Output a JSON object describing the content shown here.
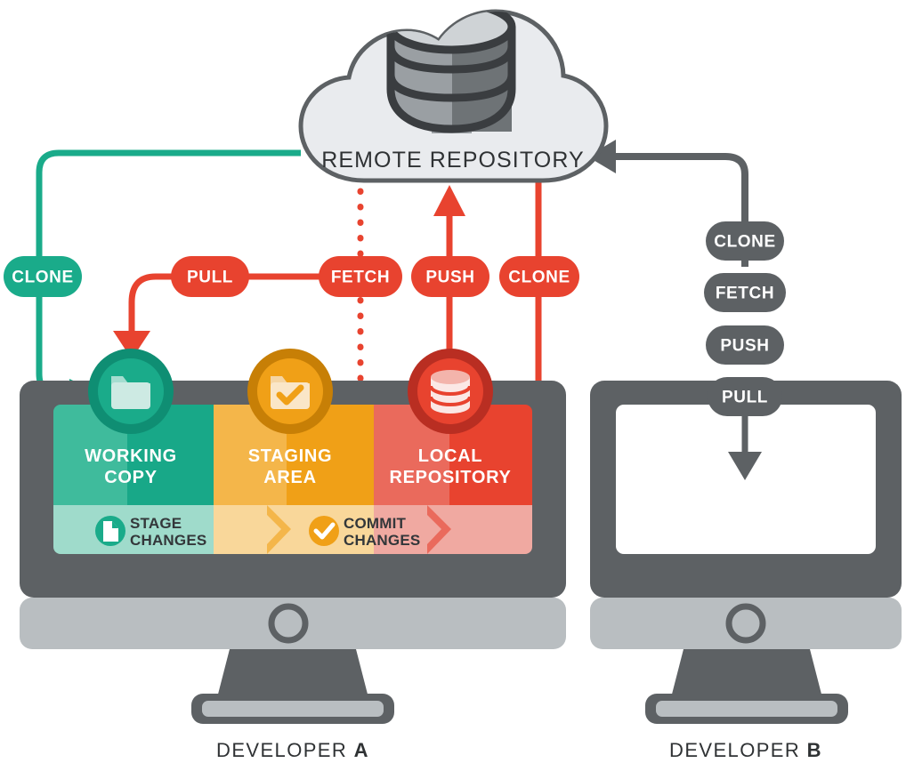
{
  "diagram": {
    "title": "Git distributed version control workflow",
    "background": "#ffffff"
  },
  "colors": {
    "green": "#1aab8a",
    "green_dark": "#0f8e73",
    "green_light": "#3fbb9c",
    "green_pale": "#9fdbcb",
    "green_icon_fill": "#cdeae3",
    "orange": "#f0a017",
    "orange_dark": "#c77f06",
    "orange_light": "#f4b64a",
    "orange_pale": "#f9d79a",
    "orange_icon_fill": "#fae6c8",
    "red": "#e8432f",
    "red_dark": "#b92e22",
    "red_light": "#ea6a5c",
    "red_pale": "#f0a9a1",
    "red_icon_fill": "#fbe8e5",
    "gray_dark": "#5d6164",
    "gray_mid": "#b9bec1",
    "gray_light": "#e9ebee",
    "ink": "#2f3234",
    "white": "#ffffff"
  },
  "cloud": {
    "label": "REMOTE REPOSITORY",
    "icon": "database-stack-icon",
    "fill": "#e9ebee",
    "stroke": "#5d6164"
  },
  "flow_labels": [
    {
      "id": "clone-green",
      "label": "CLONE",
      "color": "#1aab8a",
      "direction": "remote-to-working-copy"
    },
    {
      "id": "pull-red",
      "label": "PULL",
      "color": "#e8432f",
      "direction": "remote-to-working-copy"
    },
    {
      "id": "fetch-red",
      "label": "FETCH",
      "color": "#e8432f",
      "direction": "remote-to-local-repository"
    },
    {
      "id": "push-red",
      "label": "PUSH",
      "color": "#e8432f",
      "direction": "local-repository-to-remote"
    },
    {
      "id": "clone-red",
      "label": "CLONE",
      "color": "#e8432f",
      "direction": "remote-to-local-repository"
    }
  ],
  "developer_b_labels": [
    {
      "id": "clone-b",
      "label": "CLONE",
      "color": "#5d6164"
    },
    {
      "id": "fetch-b",
      "label": "FETCH",
      "color": "#5d6164"
    },
    {
      "id": "push-b",
      "label": "PUSH",
      "color": "#5d6164"
    },
    {
      "id": "pull-b",
      "label": "PULL",
      "color": "#5d6164"
    }
  ],
  "developer_a": {
    "caption_prefix": "DEVELOPER ",
    "caption_letter": "A",
    "columns": [
      {
        "id": "working-copy",
        "title_line1": "WORKING",
        "title_line2": "COPY",
        "icon": "folder-icon",
        "icon_ring": "#0f8e73",
        "icon_body": "#1aab8a",
        "fill_light": "#3fbb9c",
        "fill_dark": "#18a888",
        "strip_fill": "#9fdbcb"
      },
      {
        "id": "staging-area",
        "title_line1": "STAGING",
        "title_line2": "AREA",
        "icon": "folder-check-icon",
        "icon_ring": "#c77f06",
        "icon_body": "#f0a017",
        "fill_light": "#f4b64a",
        "fill_dark": "#f0a017",
        "strip_fill": "#f9d79a"
      },
      {
        "id": "local-repository",
        "title_line1": "LOCAL",
        "title_line2": "REPOSITORY",
        "icon": "database-icon",
        "icon_ring": "#b92e22",
        "icon_body": "#e8432f",
        "fill_light": "#ea6a5c",
        "fill_dark": "#e8432f",
        "strip_fill": "#f0a9a1"
      }
    ],
    "actions": [
      {
        "id": "stage-changes",
        "line1": "STAGE",
        "line2": "CHANGES",
        "icon": "file-page-icon",
        "icon_color": "#1aab8a"
      },
      {
        "id": "commit-changes",
        "line1": "COMMIT",
        "line2": "CHANGES",
        "icon": "check-circle-icon",
        "icon_color": "#f0a017"
      }
    ]
  },
  "developer_b": {
    "caption_prefix": "DEVELOPER ",
    "caption_letter": "B",
    "screen_fill": "#ffffff",
    "arrow_color": "#5d6164"
  }
}
